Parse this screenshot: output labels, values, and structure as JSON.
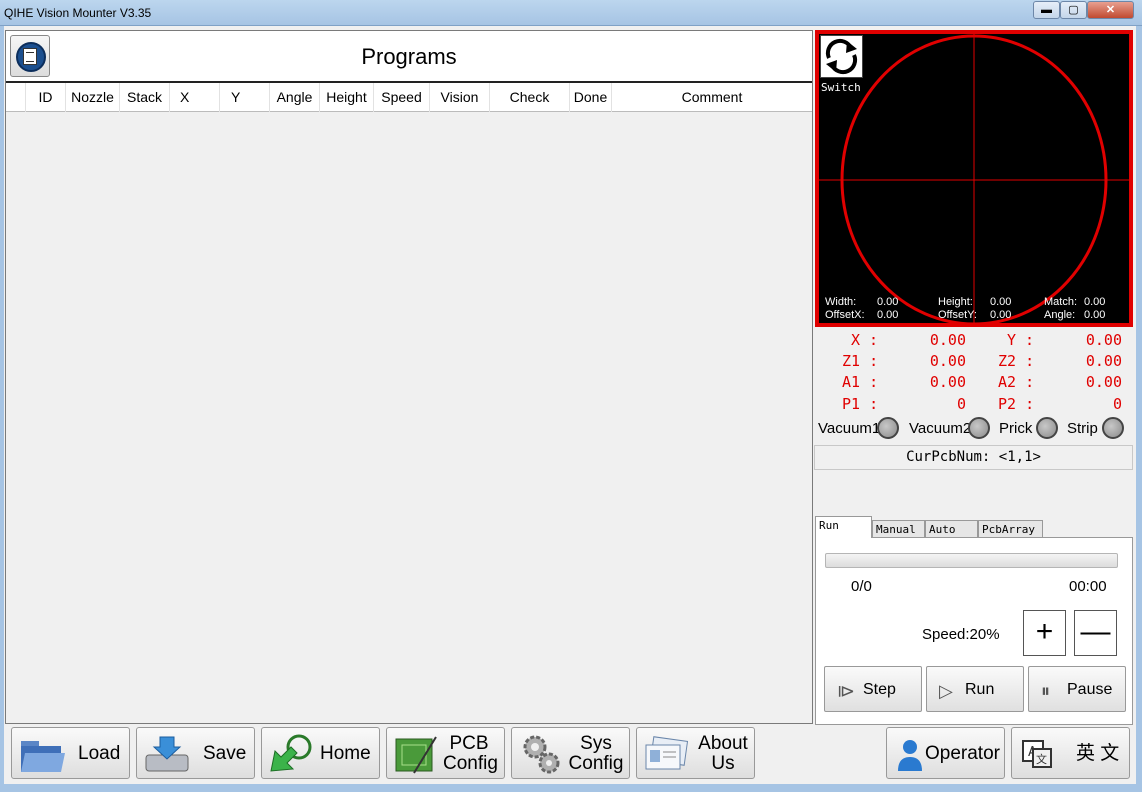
{
  "window": {
    "title": "QIHE Vision Mounter   V3.35",
    "min_glyph": "▬",
    "max_glyph": "▢",
    "close_glyph": "✕"
  },
  "programs": {
    "title": "Programs",
    "icon": "program-list-icon",
    "columns": [
      "ID",
      "Nozzle",
      "Stack",
      "X",
      "Y",
      "Angle",
      "Height",
      "Speed",
      "Vision",
      "Check",
      "Done",
      "Comment"
    ],
    "rows": []
  },
  "camera": {
    "switch_label": "Switch",
    "width_label": "Width:",
    "width_value": "0.00",
    "height_label": "Height:",
    "height_value": "0.00",
    "match_label": "Match:",
    "match_value": "0.00",
    "offsetx_label": "OffsetX:",
    "offsetx_value": "0.00",
    "offsety_label": "OffsetY:",
    "offsety_value": "0.00",
    "angle_label": "Angle:",
    "angle_value": "0.00"
  },
  "coords": {
    "x_label": "X :",
    "x_value": "0.00",
    "y_label": "Y :",
    "y_value": "0.00",
    "z1_label": "Z1 :",
    "z1_value": "0.00",
    "z2_label": "Z2 :",
    "z2_value": "0.00",
    "a1_label": "A1 :",
    "a1_value": "0.00",
    "a2_label": "A2 :",
    "a2_value": "0.00",
    "p1_label": "P1 :",
    "p1_value": "0",
    "p2_label": "P2 :",
    "p2_value": "0"
  },
  "indicators": {
    "vacuum1": "Vacuum1",
    "vacuum2": "Vacuum2",
    "prick": "Prick",
    "strip": "Strip"
  },
  "cur_pcb": "CurPcbNum: <1,1>",
  "tabs": [
    "Run",
    "Manual",
    "Auto",
    "PcbArray"
  ],
  "run": {
    "count": "0/0",
    "time": "00:00",
    "progress": 0,
    "speed": "Speed:20%",
    "plus_glyph": "+",
    "minus_glyph": "—",
    "step_label": "Step",
    "run_label": "Run",
    "pause_label": "Pause"
  },
  "toolbar": {
    "load": "Load",
    "save": "Save",
    "home": "Home",
    "pcb_line1": "PCB",
    "pcb_line2": "Config",
    "sys_line1": "Sys",
    "sys_line2": "Config",
    "about_line1": "About",
    "about_line2": "Us",
    "operator": "Operator",
    "language": "英 文"
  },
  "colors": {
    "accent_red": "#e00000",
    "camera_bg": "#000000"
  }
}
